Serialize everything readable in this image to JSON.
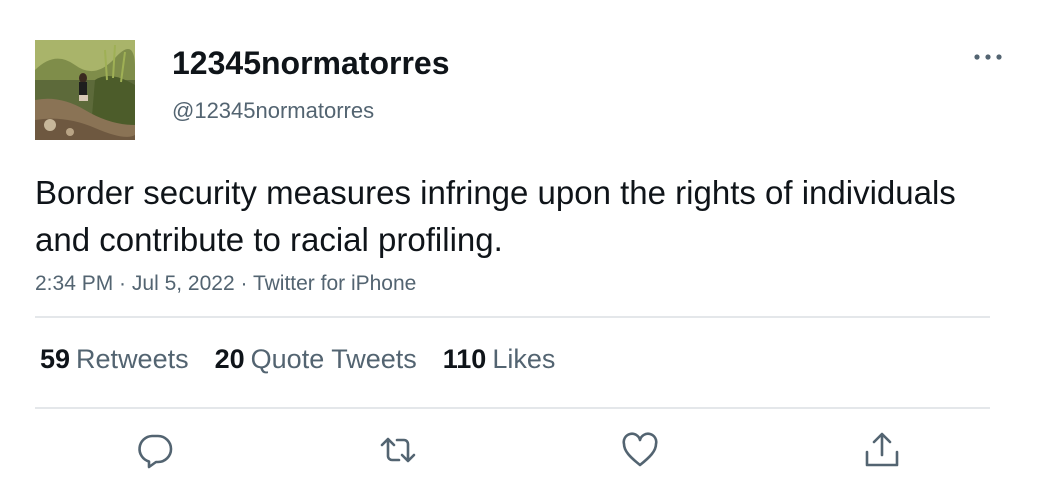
{
  "user": {
    "display_name": "12345normatorres",
    "handle": "@12345normatorres"
  },
  "tweet": {
    "text": "Border security measures infringe upon the rights of individuals and contribute to racial profiling."
  },
  "meta": {
    "time": "2:34 PM",
    "separator": " · ",
    "date": "Jul 5, 2022",
    "source": "Twitter for iPhone"
  },
  "stats": {
    "retweets_count": "59",
    "retweets_label": "Retweets",
    "quotes_count": "20",
    "quotes_label": "Quote Tweets",
    "likes_count": "110",
    "likes_label": "Likes"
  },
  "icons": {
    "more": "more-icon",
    "reply": "reply-icon",
    "retweet": "retweet-icon",
    "like": "like-icon",
    "share": "share-icon"
  },
  "colors": {
    "text_primary": "#0f1419",
    "text_secondary": "#536471",
    "divider": "#e4e7ea"
  }
}
